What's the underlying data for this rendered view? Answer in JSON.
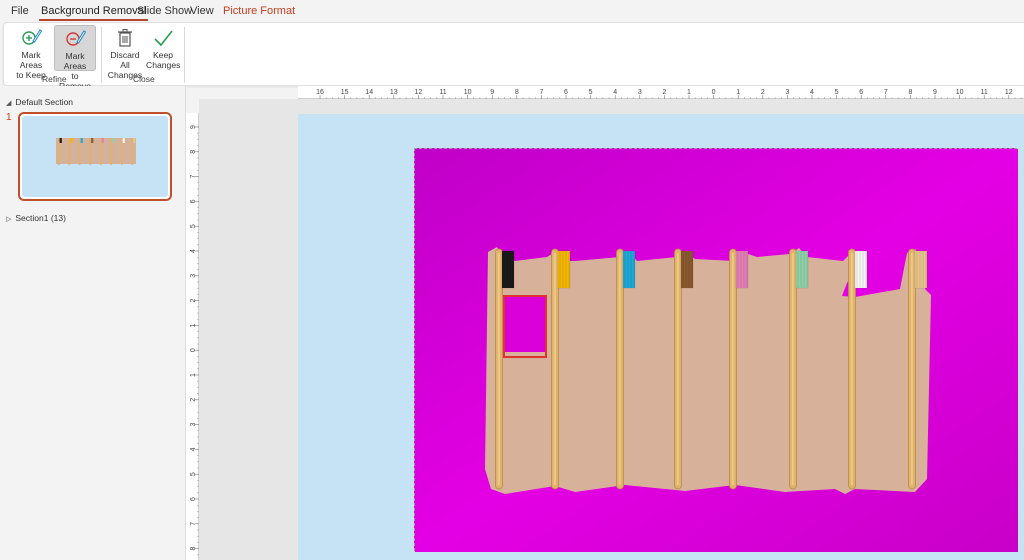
{
  "tabs": [
    "File",
    "Background Removal",
    "Slide Show",
    "View",
    "Picture Format"
  ],
  "active_tab": "Background Removal",
  "ribbon": {
    "mark_keep": {
      "line1": "Mark Areas",
      "line2": "to Keep",
      "icon": "mark-keep-icon"
    },
    "mark_remove": {
      "line1": "Mark Areas",
      "line2": "to Remove",
      "icon": "mark-remove-icon",
      "pressed": true
    },
    "refine_label": "Refine",
    "discard": {
      "line1": "Discard All",
      "line2": "Changes",
      "icon": "trash-icon"
    },
    "keep": {
      "line1": "Keep",
      "line2": "Changes",
      "icon": "checkmark-icon"
    },
    "close_label": "Close"
  },
  "left_panel": {
    "default_section": "Default Section",
    "slide_number": "1",
    "section1": "Section1 (13)"
  },
  "rulers": {
    "horizontal": [
      "16",
      "15",
      "14",
      "13",
      "12",
      "11",
      "10",
      "9",
      "8",
      "7",
      "6",
      "5",
      "4",
      "3",
      "2",
      "1",
      "0",
      "1",
      "2",
      "3",
      "4",
      "5",
      "6",
      "7",
      "8",
      "9",
      "10",
      "11",
      "12"
    ],
    "vertical": [
      "9",
      "8",
      "7",
      "6",
      "5",
      "4",
      "3",
      "2",
      "1",
      "0",
      "1",
      "2",
      "3",
      "4",
      "5",
      "6",
      "7",
      "8"
    ]
  },
  "colors": {
    "accent": "#c43e1c",
    "slide_bg": "#c5e3f4",
    "removed_area": "#d900d9",
    "mark_rect": "#e03030"
  },
  "toothbrushes": {
    "bristle_colors": [
      "#1a1a1a",
      "#f2b705",
      "#1fa8d8",
      "#8a5a2e",
      "#e27fb5",
      "#8fd1a8",
      "#f4f4f4",
      "#e7c48a"
    ]
  }
}
